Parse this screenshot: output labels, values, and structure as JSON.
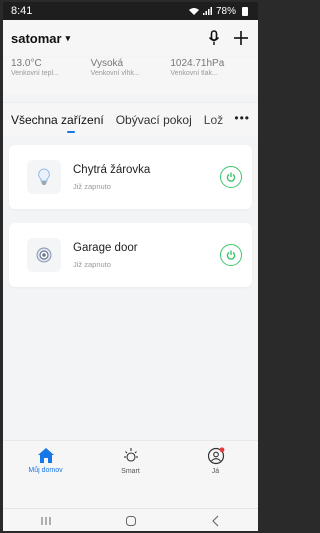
{
  "status_bar": {
    "time": "8:41",
    "right_text": "78%"
  },
  "header": {
    "home_name": "satomar"
  },
  "weather": [
    {
      "value": "13.0°C",
      "label": "Venkovní tepl..."
    },
    {
      "value": "Vysoká",
      "label": "Venkovní vlhk..."
    },
    {
      "value": "1024.71hPa",
      "label": "Venkovní tlak..."
    }
  ],
  "tabs": [
    {
      "label": "Všechna zařízení"
    },
    {
      "label": "Obývací pokoj"
    },
    {
      "label": "Lož"
    }
  ],
  "devices": [
    {
      "name": "Chytrá žárovka",
      "status": "Již zapnuto",
      "icon": "bulb-icon"
    },
    {
      "name": "Garage door",
      "status": "Již zapnuto",
      "icon": "garage-door-icon"
    }
  ],
  "bottom_nav": [
    {
      "label": "Můj domov",
      "icon": "home-icon"
    },
    {
      "label": "Smart",
      "icon": "sun-icon"
    },
    {
      "label": "Já",
      "icon": "profile-icon"
    }
  ],
  "colors": {
    "accent": "#1677e6",
    "power": "#3cc46a"
  }
}
